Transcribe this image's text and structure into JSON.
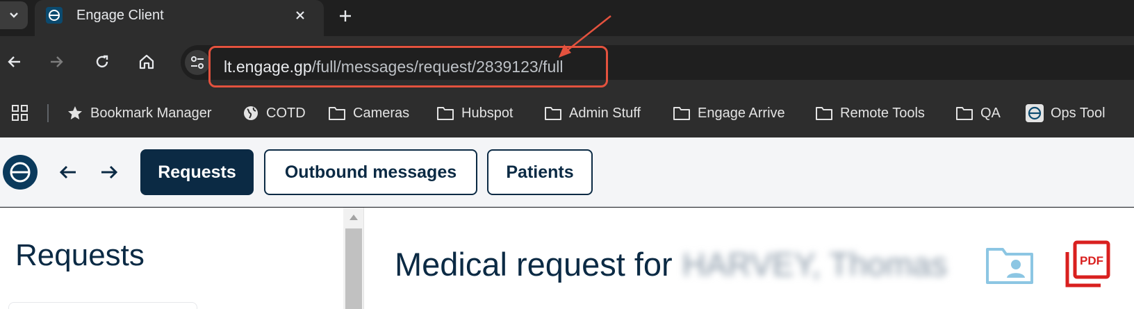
{
  "browser": {
    "tab": {
      "title": "Engage Client",
      "favicon": "engage-logo-icon"
    },
    "url": {
      "host": "lt.engage.gp",
      "path": "/full/messages/request/2839123/full"
    },
    "annotation": {
      "color": "#e4523e"
    },
    "bookmarks": [
      {
        "label": "Bookmark Manager",
        "icon": "star-icon"
      },
      {
        "label": "COTD",
        "icon": "globe-icon"
      },
      {
        "label": "Cameras",
        "icon": "folder-icon"
      },
      {
        "label": "Hubspot",
        "icon": "folder-icon"
      },
      {
        "label": "Admin Stuff",
        "icon": "folder-icon"
      },
      {
        "label": "Engage Arrive",
        "icon": "folder-icon"
      },
      {
        "label": "Remote Tools",
        "icon": "folder-icon"
      },
      {
        "label": "QA",
        "icon": "folder-icon"
      },
      {
        "label": "Ops Tool",
        "icon": "engage-logo-icon"
      }
    ]
  },
  "app": {
    "colors": {
      "primary": "#0b2a44",
      "folder": "#8cc6e3",
      "pdf": "#d9201f"
    },
    "tabs": [
      {
        "label": "Requests",
        "active": true
      },
      {
        "label": "Outbound messages",
        "active": false
      },
      {
        "label": "Patients",
        "active": false
      }
    ],
    "sidebar": {
      "title": "Requests"
    },
    "main": {
      "heading_prefix": "Medical request for",
      "patient_name": "HARVEY, Thomas"
    }
  }
}
